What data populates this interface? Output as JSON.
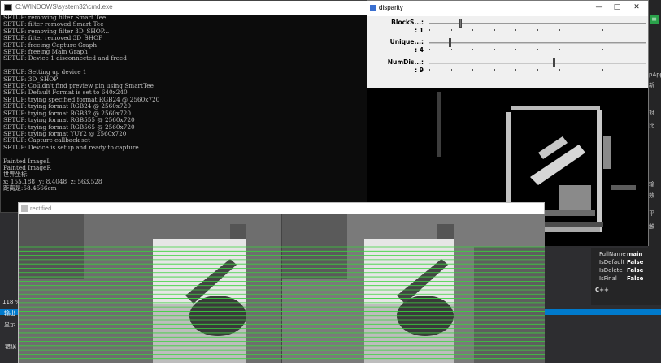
{
  "ide": {
    "right_labels": [
      "pApp",
      "新",
      "对",
      "比",
      "输",
      "效",
      "平",
      "触"
    ],
    "properties": [
      {
        "name": "FullName",
        "value": "main"
      },
      {
        "name": "IsDefault",
        "value": "False"
      },
      {
        "name": "IsDelete",
        "value": "False"
      },
      {
        "name": "IsFinal",
        "value": "False"
      },
      {
        "name": "C++",
        "value": ""
      }
    ],
    "bottom_tabs": [
      "输出",
      "显示",
      "118 %",
      "错误"
    ]
  },
  "cmd": {
    "title": "C:\\WINDOWS\\system32\\cmd.exe",
    "lines": [
      "SETUP: removing filter Smart Tee...",
      "SETUP: filter removed Smart Tee",
      "SETUP: removing filter 3D_SHOP...",
      "SETUP: filter removed 3D_SHOP",
      "SETUP: freeing Capture Graph",
      "SETUP: freeing Main Graph",
      "SETUP: Device 1 disconnected and freed",
      "",
      "SETUP: Setting up device 1",
      "SETUP: 3D_SHOP",
      "SETUP: Couldn't find preview pin using SmartTee",
      "SETUP: Default Format is set to 640x240",
      "SETUP: trying specified format RGB24 @ 2560x720",
      "SETUP: trying format RGB24 @ 2560x720",
      "SETUP: trying format RGB32 @ 2560x720",
      "SETUP: trying format RGB555 @ 2560x720",
      "SETUP: trying format RGB565 @ 2560x720",
      "SETUP: trying format YUY2 @ 2560x720",
      "SETUP: Capture callback set",
      "SETUP: Device is setup and ready to capture.",
      "",
      "Painted ImageL",
      "Painted ImageR",
      "世界坐标:",
      "x: 155.188  y: 8.4048  z: 563.528",
      "距离是:58.4566cm"
    ]
  },
  "disparity": {
    "title": "disparity",
    "buttons": {
      "minimize": "—",
      "maximize": "□",
      "close": "✕"
    },
    "trackbars": [
      {
        "label": "BlockS...:",
        "value": ": 1",
        "position": 0.14
      },
      {
        "label": "Unique...:",
        "value": ": 4",
        "position": 0.09
      },
      {
        "label": "NumDis...:",
        "value": ": 9",
        "position": 0.57
      }
    ]
  },
  "rectified": {
    "title": "rectified",
    "line_color": "#39d33c",
    "line_count": 27
  }
}
